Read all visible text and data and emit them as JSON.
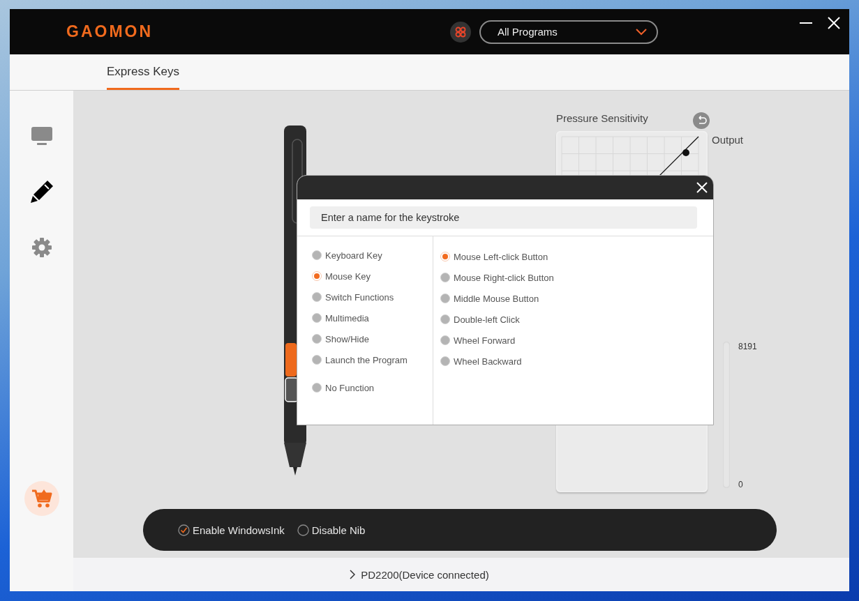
{
  "window": {
    "logo": "GAOMON",
    "program_select": {
      "value": "All Programs"
    }
  },
  "tabs": [
    {
      "label": "Express Keys",
      "selected": true
    }
  ],
  "sidebar": {
    "items": [
      {
        "kind": "display",
        "selected": false
      },
      {
        "kind": "pen",
        "selected": true
      },
      {
        "kind": "settings",
        "selected": false
      }
    ]
  },
  "pressure": {
    "title": "Pressure Sensitivity",
    "output_label": "Output",
    "max_label": "8191",
    "min_label": "0"
  },
  "options": [
    {
      "label": "Enable WindowsInk",
      "checked": true
    },
    {
      "label": "Disable Nib",
      "checked": false
    }
  ],
  "dialog": {
    "name_field": {
      "placeholder": "Enter a name for the keystroke"
    },
    "categories": [
      {
        "label": "Keyboard Key",
        "selected": false
      },
      {
        "label": "Mouse Key",
        "selected": true
      },
      {
        "label": "Switch Functions",
        "selected": false
      },
      {
        "label": "Multimedia",
        "selected": false
      },
      {
        "label": "Show/Hide",
        "selected": false
      },
      {
        "label": "Launch the Program",
        "selected": false
      },
      {
        "label": "No Function",
        "selected": false
      }
    ],
    "actions": [
      {
        "label": "Mouse Left-click Button",
        "selected": true
      },
      {
        "label": "Mouse Right-click Button",
        "selected": false
      },
      {
        "label": "Middle Mouse Button",
        "selected": false
      },
      {
        "label": "Double-left Click",
        "selected": false
      },
      {
        "label": "Wheel Forward",
        "selected": false
      },
      {
        "label": "Wheel Backward",
        "selected": false
      }
    ]
  },
  "status_bar": {
    "device": "PD2200(Device connected)"
  }
}
